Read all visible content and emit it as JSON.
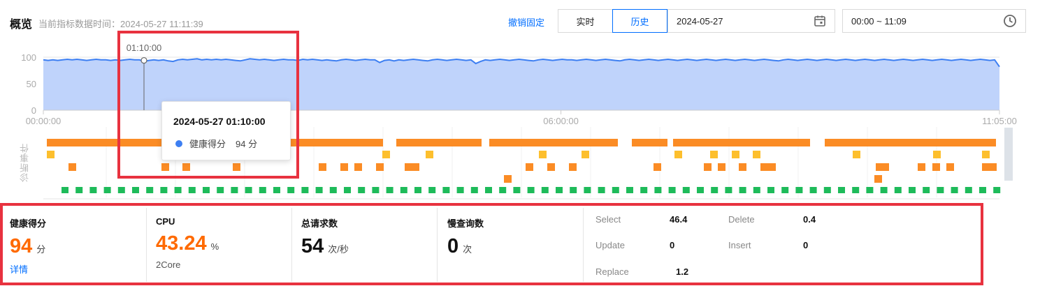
{
  "header": {
    "title": "概览",
    "subtitle": "当前指标数据时间：2024-05-27 11:11:39",
    "unpin_label": "撤销固定",
    "mode_realtime": "实时",
    "mode_history": "历史",
    "date_value": "2024-05-27",
    "time_range": "00:00 ~ 11:09",
    "icons": {
      "date": "calendar-icon",
      "time": "clock-icon"
    }
  },
  "chart_data": {
    "type": "area",
    "series": [
      {
        "values": [
          95,
          94,
          95,
          94,
          95,
          96,
          95,
          96,
          95,
          94,
          95,
          96,
          95,
          95,
          94,
          95,
          94,
          95,
          96,
          95,
          95,
          92,
          94,
          95,
          94,
          95,
          93,
          92,
          95,
          96,
          95,
          96,
          97,
          95,
          96,
          95,
          96,
          95,
          96,
          95,
          94,
          93,
          95,
          97,
          96,
          95,
          96,
          95,
          94,
          95,
          96,
          95,
          95,
          94,
          96,
          95,
          96,
          95,
          94,
          95,
          94,
          93,
          95,
          96,
          95,
          94,
          95,
          96,
          95,
          95,
          90,
          94,
          95,
          93,
          95,
          94,
          95,
          96,
          95,
          94,
          93,
          95,
          96,
          95,
          94,
          95,
          96,
          95,
          94,
          95,
          88,
          92,
          95,
          94,
          95,
          96,
          95,
          94,
          95,
          96,
          95,
          94,
          93,
          95,
          96,
          95,
          94,
          95,
          96,
          95,
          95,
          94,
          95,
          96,
          95,
          94,
          95,
          96,
          95,
          94,
          93,
          95,
          96,
          95,
          94,
          95,
          96,
          95,
          94,
          95,
          96,
          95,
          94,
          95,
          96,
          95,
          94,
          95,
          96,
          95,
          94,
          95,
          96,
          95,
          94,
          95,
          96,
          95,
          94,
          95,
          96,
          95,
          94,
          93,
          95,
          96,
          95,
          94,
          95,
          96,
          95,
          94,
          95,
          96,
          95,
          94,
          95,
          96,
          95,
          94,
          95,
          96,
          95,
          94,
          95,
          96,
          95,
          94,
          95,
          96,
          95,
          94,
          95,
          96,
          95,
          94,
          95,
          96,
          95,
          94,
          95,
          96,
          95,
          94,
          95,
          96,
          95,
          94,
          95,
          82
        ]
      }
    ],
    "x_tick_labels": [
      "00:00:00",
      "06:00:00",
      "11:05:00"
    ],
    "y_tick_labels": [
      "100",
      "50",
      "0"
    ],
    "ylim": [
      0,
      100
    ],
    "xlim_minutes": [
      0,
      665
    ],
    "grid": true,
    "hover": {
      "label": "01:10:00",
      "x_minutes": 70,
      "value": 94
    },
    "colors": {
      "line": "#3d7ff2",
      "area": "#bfd3fb",
      "grid": "#e6e6e6",
      "axis": "#cccccc",
      "tick": "#aaaaaa"
    }
  },
  "events": {
    "label": "诊断事件",
    "colors": {
      "long": "#fb8c25",
      "yellow": "#fdbf2d",
      "orange": "#fb8c25",
      "green": "#1ebb5a"
    }
  },
  "tooltip": {
    "time": "2024-05-27 01:10:00",
    "metric": "健康得分",
    "value": "94 分",
    "dot_color": "#3d7ff2"
  },
  "cards": {
    "health": {
      "label": "健康得分",
      "value": "94",
      "unit": "分",
      "link": "详情",
      "color": "#ff6a00"
    },
    "cpu": {
      "label": "CPU",
      "value": "43.24",
      "unit": "%",
      "sub": "2Core",
      "color": "#ff6a00"
    },
    "requests": {
      "label": "总请求数",
      "value": "54",
      "unit": "次/秒",
      "color": "#111111"
    },
    "slow": {
      "label": "慢查询数",
      "value": "0",
      "unit": "次",
      "color": "#111111"
    }
  },
  "stats": {
    "select_label": "Select",
    "select_value": "46.4",
    "delete_label": "Delete",
    "delete_value": "0.4",
    "update_label": "Update",
    "update_value": "0",
    "insert_label": "Insert",
    "insert_value": "0",
    "replace_label": "Replace",
    "replace_value": "1.2"
  }
}
